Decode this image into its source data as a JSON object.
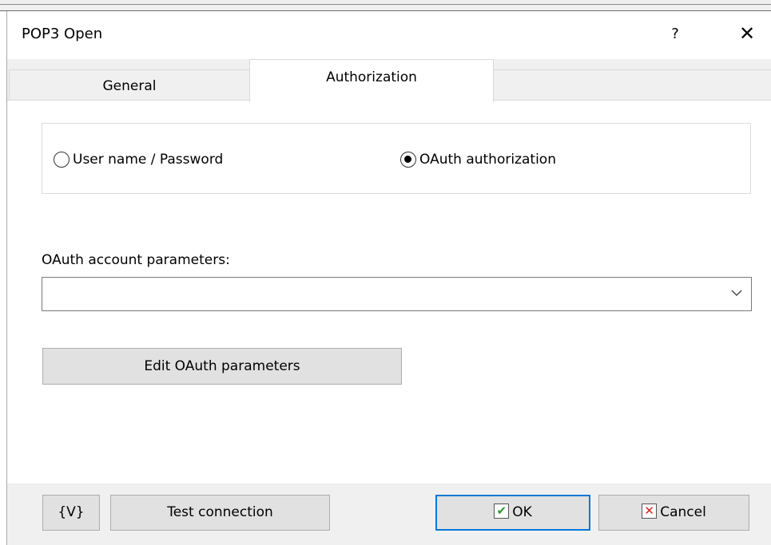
{
  "window": {
    "title": "POP3 Open",
    "help_label": "?",
    "close_label": "✕"
  },
  "tabs": [
    {
      "label": "General",
      "active": false
    },
    {
      "label": "Authorization",
      "active": true
    }
  ],
  "auth_mode": {
    "options": [
      {
        "label": "User name / Password",
        "checked": false
      },
      {
        "label": "OAuth authorization",
        "checked": true
      }
    ]
  },
  "oauth": {
    "params_label": "OAuth account parameters:",
    "params_value": "",
    "edit_button_label": "Edit OAuth parameters"
  },
  "footer": {
    "variables_label": "{V}",
    "test_label": "Test connection",
    "ok_label": "OK",
    "cancel_label": "Cancel"
  },
  "icons": {
    "dropdown": "chevron-down-icon",
    "ok": "checkmark-icon",
    "cancel": "x-icon"
  },
  "colors": {
    "accent": "#0078d7",
    "ok_check": "#2a9d2a",
    "cancel_x": "#e02020"
  }
}
